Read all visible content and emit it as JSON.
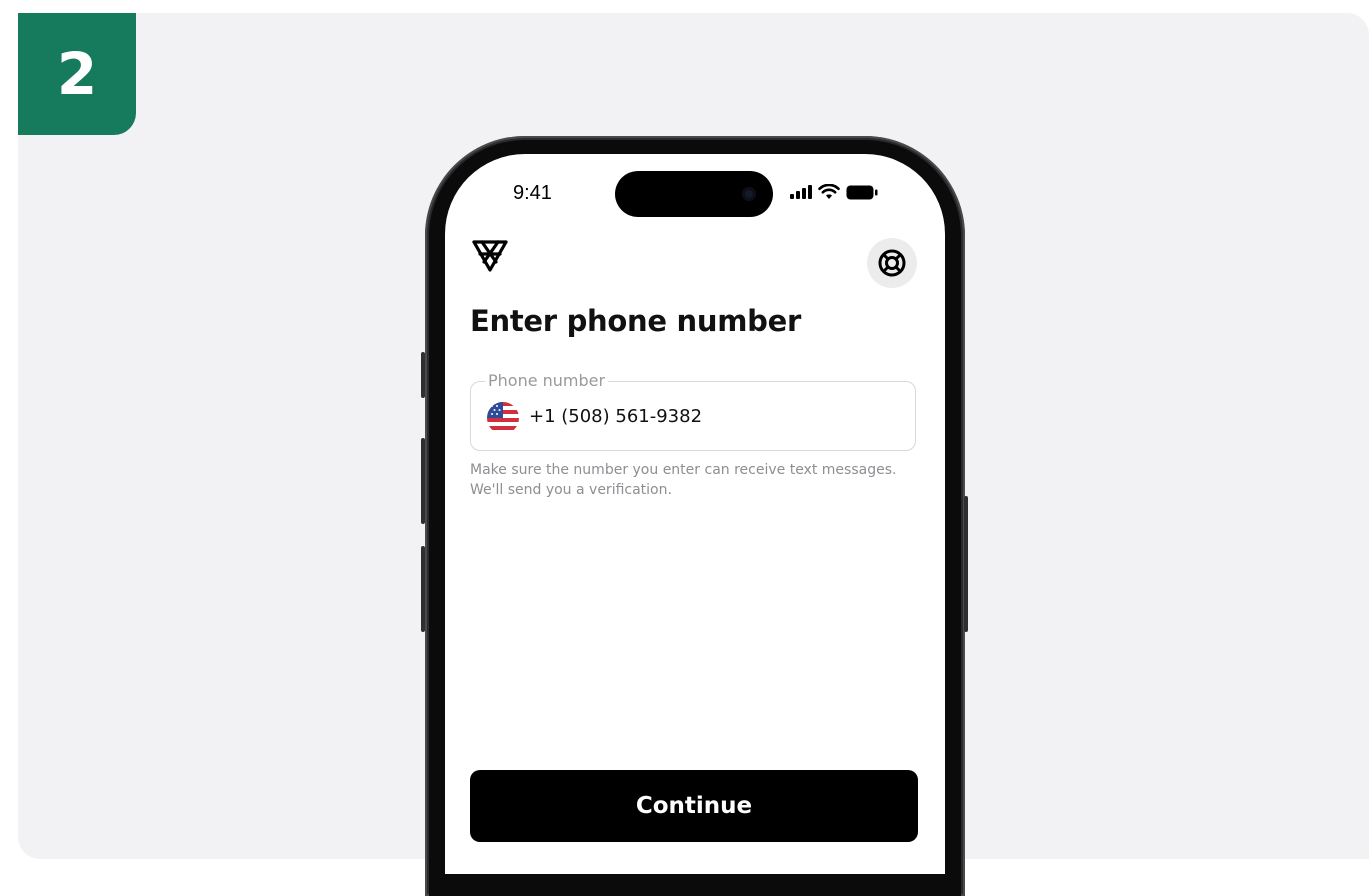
{
  "step": {
    "number": "2",
    "color": "#167a5d"
  },
  "status_bar": {
    "time": "9:41",
    "icons": [
      "signal-icon",
      "wifi-icon",
      "battery-icon"
    ]
  },
  "header": {
    "logo": "brand-logo-icon",
    "help_icon": "lifebuoy-icon"
  },
  "page": {
    "title": "Enter phone number"
  },
  "phone_field": {
    "label": "Phone number",
    "country_icon": "us-flag-icon",
    "value": "+1 (508) 561-9382"
  },
  "helper_text": {
    "line1": "Make sure the number you enter can receive text messages.",
    "line2": "We'll send you a verification."
  },
  "actions": {
    "continue_label": "Continue"
  }
}
